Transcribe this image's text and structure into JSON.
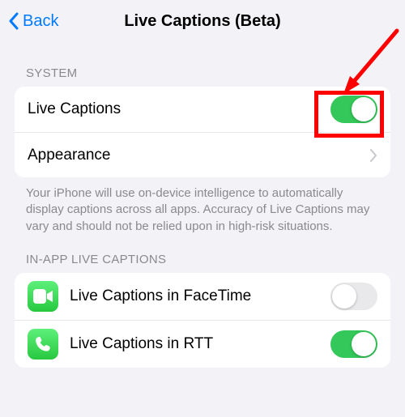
{
  "nav": {
    "back_label": "Back",
    "title": "Live Captions (Beta)"
  },
  "sections": {
    "system": {
      "header": "SYSTEM",
      "rows": {
        "live_captions": {
          "label": "Live Captions",
          "on": true
        },
        "appearance": {
          "label": "Appearance"
        }
      },
      "footer": "Your iPhone will use on-device intelligence to automatically display captions across all apps. Accuracy of Live Captions may vary and should not be relied upon in high-risk situations."
    },
    "in_app": {
      "header": "IN-APP LIVE CAPTIONS",
      "rows": {
        "facetime": {
          "label": "Live Captions in FaceTime",
          "on": false
        },
        "rtt": {
          "label": "Live Captions in RTT",
          "on": true
        }
      }
    }
  },
  "colors": {
    "accent": "#007aff",
    "toggle_on": "#34c759",
    "annotation": "#ff0000"
  }
}
